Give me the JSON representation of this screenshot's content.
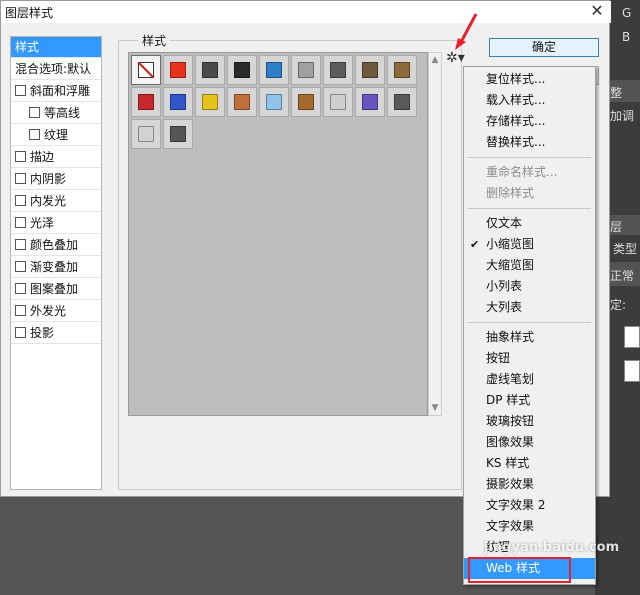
{
  "dialog": {
    "title": "图层样式",
    "close_glyph": "✕"
  },
  "left_panel": {
    "items": [
      {
        "label": "样式",
        "checkbox": false,
        "selected": true
      },
      {
        "label": "混合选项:默认",
        "checkbox": false,
        "selected": false
      },
      {
        "label": "斜面和浮雕",
        "checkbox": true,
        "selected": false
      },
      {
        "label": "等高线",
        "checkbox": true,
        "selected": false,
        "indent": true
      },
      {
        "label": "纹理",
        "checkbox": true,
        "selected": false,
        "indent": true
      },
      {
        "label": "描边",
        "checkbox": true,
        "selected": false
      },
      {
        "label": "内阴影",
        "checkbox": true,
        "selected": false
      },
      {
        "label": "内发光",
        "checkbox": true,
        "selected": false
      },
      {
        "label": "光泽",
        "checkbox": true,
        "selected": false
      },
      {
        "label": "颜色叠加",
        "checkbox": true,
        "selected": false
      },
      {
        "label": "渐变叠加",
        "checkbox": true,
        "selected": false
      },
      {
        "label": "图案叠加",
        "checkbox": true,
        "selected": false
      },
      {
        "label": "外发光",
        "checkbox": true,
        "selected": false
      },
      {
        "label": "投影",
        "checkbox": true,
        "selected": false
      }
    ]
  },
  "styles_group": {
    "label": "样式",
    "tiles": [
      {
        "name": "none-style",
        "color": "#ffffff"
      },
      {
        "name": "red-glow-style",
        "color": "#e8331c"
      },
      {
        "name": "dark-square-style",
        "color": "#4a4a4a"
      },
      {
        "name": "camera-style",
        "color": "#2b2b2b"
      },
      {
        "name": "blue-glass-style",
        "color": "#2d7fc9"
      },
      {
        "name": "gray-style",
        "color": "#a0a0a0"
      },
      {
        "name": "metal-style",
        "color": "#5c5c5c"
      },
      {
        "name": "brown-style",
        "color": "#6e5a3a"
      },
      {
        "name": "gold-brown-style",
        "color": "#8d6b3a"
      },
      {
        "name": "red-stripe-style",
        "color": "#c8282c"
      },
      {
        "name": "rainbow-style",
        "color": "#3355cc"
      },
      {
        "name": "yellow-style",
        "color": "#e5c31a"
      },
      {
        "name": "copper-style",
        "color": "#c0703a"
      },
      {
        "name": "sky-blue-style",
        "color": "#8fc3ea"
      },
      {
        "name": "sunset-style",
        "color": "#a46b2c"
      },
      {
        "name": "crosshatch-style",
        "color": "#cfcfcf"
      },
      {
        "name": "purple-style",
        "color": "#6a55c0"
      },
      {
        "name": "dark-gray-style",
        "color": "#5a5a5a"
      },
      {
        "name": "light-square-style",
        "color": "#d2d2d2"
      },
      {
        "name": "charcoal-style",
        "color": "#565656"
      }
    ]
  },
  "buttons": {
    "ok_label": "确定"
  },
  "gear_glyph": "✲▾",
  "menu": {
    "items": [
      {
        "label": "复位样式...",
        "disabled": false
      },
      {
        "label": "载入样式...",
        "disabled": false
      },
      {
        "label": "存储样式...",
        "disabled": false
      },
      {
        "label": "替换样式...",
        "disabled": false
      },
      {
        "sep": true
      },
      {
        "label": "重命名样式...",
        "disabled": true
      },
      {
        "label": "删除样式",
        "disabled": true
      },
      {
        "sep": true
      },
      {
        "label": "仅文本",
        "disabled": false
      },
      {
        "label": "小缩览图",
        "disabled": false,
        "checked": true
      },
      {
        "label": "大缩览图",
        "disabled": false
      },
      {
        "label": "小列表",
        "disabled": false
      },
      {
        "label": "大列表",
        "disabled": false
      },
      {
        "sep": true
      },
      {
        "label": "抽象样式",
        "disabled": false
      },
      {
        "label": "按钮",
        "disabled": false
      },
      {
        "label": "虚线笔划",
        "disabled": false
      },
      {
        "label": "DP 样式",
        "disabled": false
      },
      {
        "label": "玻璃按钮",
        "disabled": false
      },
      {
        "label": "图像效果",
        "disabled": false
      },
      {
        "label": "KS 样式",
        "disabled": false
      },
      {
        "label": "摄影效果",
        "disabled": false
      },
      {
        "label": "文字效果 2",
        "disabled": false
      },
      {
        "label": "文字效果",
        "disabled": false
      },
      {
        "label": "纹理",
        "disabled": false
      },
      {
        "label": "Web 样式",
        "disabled": false,
        "highlighted": true
      }
    ]
  },
  "background_app": {
    "labels": [
      "G",
      "B",
      "整",
      "加调",
      "层",
      "类型",
      "正常",
      "定:"
    ]
  },
  "watermark": "jingyan.baidu.com"
}
